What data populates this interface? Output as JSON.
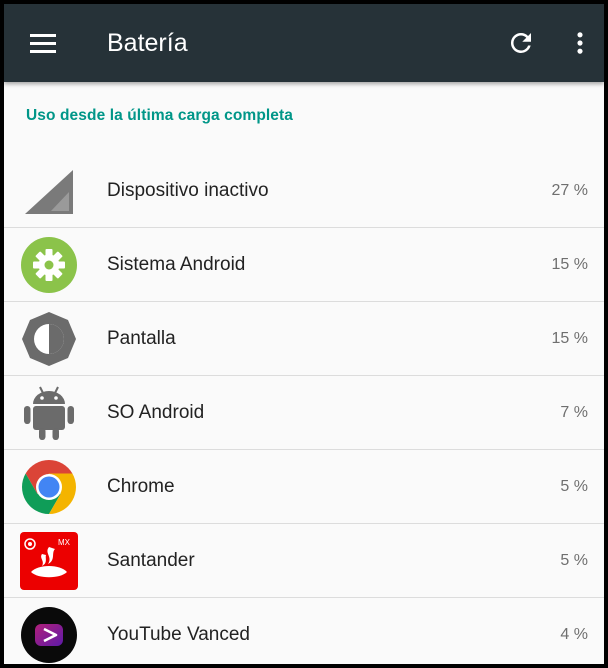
{
  "app_bar": {
    "title": "Batería",
    "background": "#263238",
    "icons": [
      "menu-icon",
      "refresh-icon",
      "more-vert-icon"
    ]
  },
  "section_header": "Uso desde la última carga completa",
  "accent_color": "#009688",
  "items": [
    {
      "label": "Dispositivo inactivo",
      "value": "27 %",
      "icon": "signal-strength-icon"
    },
    {
      "label": "Sistema Android",
      "value": "15 %",
      "icon": "android-system-gear-icon"
    },
    {
      "label": "Pantalla",
      "value": "15 %",
      "icon": "brightness-icon"
    },
    {
      "label": "SO Android",
      "value": "7 %",
      "icon": "android-robot-icon"
    },
    {
      "label": "Chrome",
      "value": "5 %",
      "icon": "chrome-icon"
    },
    {
      "label": "Santander",
      "value": "5 %",
      "icon": "santander-icon",
      "badge": "MX"
    },
    {
      "label": "YouTube Vanced",
      "value": "4 %",
      "icon": "youtube-vanced-icon"
    }
  ]
}
